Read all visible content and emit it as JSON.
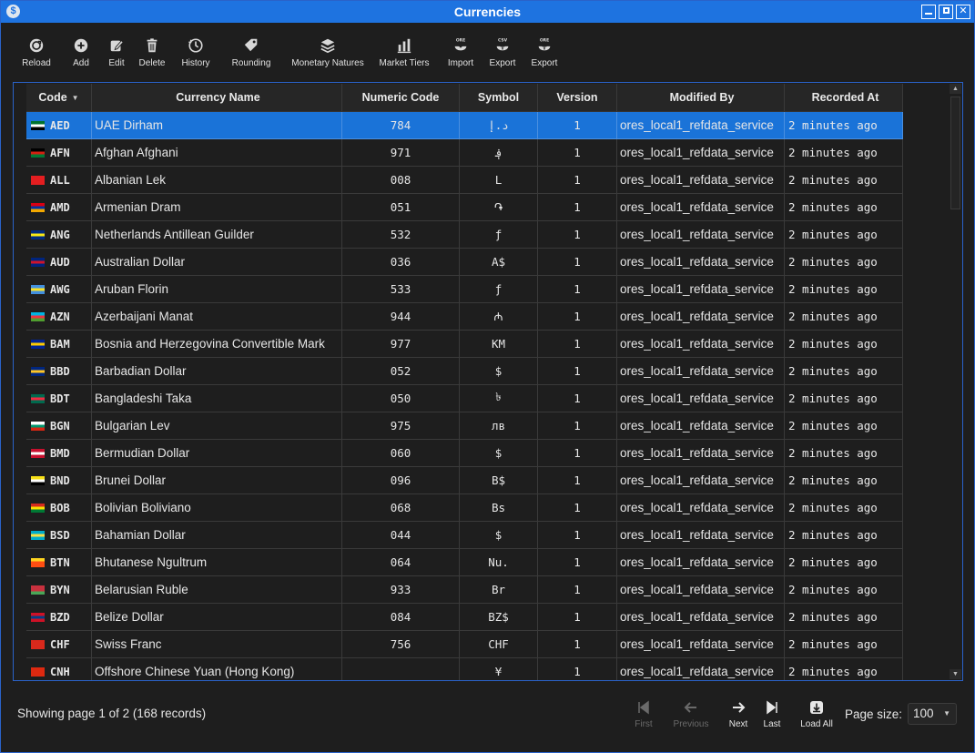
{
  "window": {
    "title": "Currencies",
    "app_icon": "$"
  },
  "toolbar": [
    {
      "name": "reload",
      "label": "Reload"
    },
    {
      "name": "add",
      "label": "Add"
    },
    {
      "name": "edit",
      "label": "Edit"
    },
    {
      "name": "delete",
      "label": "Delete"
    },
    {
      "name": "history",
      "label": "History"
    },
    {
      "name": "rounding",
      "label": "Rounding"
    },
    {
      "name": "monetary-natures",
      "label": "Monetary Natures"
    },
    {
      "name": "market-tiers",
      "label": "Market Tiers"
    },
    {
      "name": "import",
      "label": "Import",
      "badge": "ORE"
    },
    {
      "name": "export-csv",
      "label": "Export",
      "badge": "CSV"
    },
    {
      "name": "export-ore",
      "label": "Export",
      "badge": "ORE"
    }
  ],
  "table": {
    "columns": [
      "Code",
      "Currency Name",
      "Numeric Code",
      "Symbol",
      "Version",
      "Modified By",
      "Recorded At"
    ],
    "rows": [
      {
        "code": "AED",
        "name": "UAE Dirham",
        "numeric": "784",
        "symbol": "د.إ",
        "version": "1",
        "modified_by": "ores_local1_refdata_service",
        "recorded_at": "2 minutes ago",
        "flag": [
          "#00732f",
          "#ffffff",
          "#000000",
          "#ff0000"
        ]
      },
      {
        "code": "AFN",
        "name": "Afghan Afghani",
        "numeric": "971",
        "symbol": "؋",
        "version": "1",
        "modified_by": "ores_local1_refdata_service",
        "recorded_at": "2 minutes ago",
        "flag": [
          "#000000",
          "#d32011",
          "#007a36"
        ]
      },
      {
        "code": "ALL",
        "name": "Albanian Lek",
        "numeric": "008",
        "symbol": "L",
        "version": "1",
        "modified_by": "ores_local1_refdata_service",
        "recorded_at": "2 minutes ago",
        "flag": [
          "#e41e20",
          "#e41e20",
          "#e41e20"
        ]
      },
      {
        "code": "AMD",
        "name": "Armenian Dram",
        "numeric": "051",
        "symbol": "֏",
        "version": "1",
        "modified_by": "ores_local1_refdata_service",
        "recorded_at": "2 minutes ago",
        "flag": [
          "#d90012",
          "#0033a0",
          "#f2a800"
        ]
      },
      {
        "code": "ANG",
        "name": "Netherlands Antillean Guilder",
        "numeric": "532",
        "symbol": "ƒ",
        "version": "1",
        "modified_by": "ores_local1_refdata_service",
        "recorded_at": "2 minutes ago",
        "flag": [
          "#002b7f",
          "#f9e814",
          "#002b7f"
        ]
      },
      {
        "code": "AUD",
        "name": "Australian Dollar",
        "numeric": "036",
        "symbol": "A$",
        "version": "1",
        "modified_by": "ores_local1_refdata_service",
        "recorded_at": "2 minutes ago",
        "flag": [
          "#00247d",
          "#cf142b",
          "#00247d"
        ]
      },
      {
        "code": "AWG",
        "name": "Aruban Florin",
        "numeric": "533",
        "symbol": "ƒ",
        "version": "1",
        "modified_by": "ores_local1_refdata_service",
        "recorded_at": "2 minutes ago",
        "flag": [
          "#418fde",
          "#fbe122",
          "#418fde"
        ]
      },
      {
        "code": "AZN",
        "name": "Azerbaijani Manat",
        "numeric": "944",
        "symbol": "₼",
        "version": "1",
        "modified_by": "ores_local1_refdata_service",
        "recorded_at": "2 minutes ago",
        "flag": [
          "#00b5e2",
          "#ef3340",
          "#509e2f"
        ]
      },
      {
        "code": "BAM",
        "name": "Bosnia and Herzegovina Convertible Mark",
        "numeric": "977",
        "symbol": "KM",
        "version": "1",
        "modified_by": "ores_local1_refdata_service",
        "recorded_at": "2 minutes ago",
        "flag": [
          "#002395",
          "#fecb00",
          "#002395"
        ]
      },
      {
        "code": "BBD",
        "name": "Barbadian Dollar",
        "numeric": "052",
        "symbol": "$",
        "version": "1",
        "modified_by": "ores_local1_refdata_service",
        "recorded_at": "2 minutes ago",
        "flag": [
          "#00267f",
          "#ffc726",
          "#00267f"
        ]
      },
      {
        "code": "BDT",
        "name": "Bangladeshi Taka",
        "numeric": "050",
        "symbol": "৳",
        "version": "1",
        "modified_by": "ores_local1_refdata_service",
        "recorded_at": "2 minutes ago",
        "flag": [
          "#006a4e",
          "#f42a41",
          "#006a4e"
        ]
      },
      {
        "code": "BGN",
        "name": "Bulgarian Lev",
        "numeric": "975",
        "symbol": "лв",
        "version": "1",
        "modified_by": "ores_local1_refdata_service",
        "recorded_at": "2 minutes ago",
        "flag": [
          "#ffffff",
          "#00966e",
          "#d62612"
        ]
      },
      {
        "code": "BMD",
        "name": "Bermudian Dollar",
        "numeric": "060",
        "symbol": "$",
        "version": "1",
        "modified_by": "ores_local1_refdata_service",
        "recorded_at": "2 minutes ago",
        "flag": [
          "#c8102e",
          "#ffffff",
          "#c8102e"
        ]
      },
      {
        "code": "BND",
        "name": "Brunei Dollar",
        "numeric": "096",
        "symbol": "B$",
        "version": "1",
        "modified_by": "ores_local1_refdata_service",
        "recorded_at": "2 minutes ago",
        "flag": [
          "#f7e017",
          "#ffffff",
          "#000000"
        ]
      },
      {
        "code": "BOB",
        "name": "Bolivian Boliviano",
        "numeric": "068",
        "symbol": "Bs",
        "version": "1",
        "modified_by": "ores_local1_refdata_service",
        "recorded_at": "2 minutes ago",
        "flag": [
          "#d52b1e",
          "#f9e300",
          "#007934"
        ]
      },
      {
        "code": "BSD",
        "name": "Bahamian Dollar",
        "numeric": "044",
        "symbol": "$",
        "version": "1",
        "modified_by": "ores_local1_refdata_service",
        "recorded_at": "2 minutes ago",
        "flag": [
          "#00abc9",
          "#fae042",
          "#00abc9"
        ]
      },
      {
        "code": "BTN",
        "name": "Bhutanese Ngultrum",
        "numeric": "064",
        "symbol": "Nu.",
        "version": "1",
        "modified_by": "ores_local1_refdata_service",
        "recorded_at": "2 minutes ago",
        "flag": [
          "#ffd520",
          "#ff4e12",
          "#ff4e12"
        ]
      },
      {
        "code": "BYN",
        "name": "Belarusian Ruble",
        "numeric": "933",
        "symbol": "Br",
        "version": "1",
        "modified_by": "ores_local1_refdata_service",
        "recorded_at": "2 minutes ago",
        "flag": [
          "#c8313e",
          "#c8313e",
          "#4aa657"
        ]
      },
      {
        "code": "BZD",
        "name": "Belize Dollar",
        "numeric": "084",
        "symbol": "BZ$",
        "version": "1",
        "modified_by": "ores_local1_refdata_service",
        "recorded_at": "2 minutes ago",
        "flag": [
          "#ce1126",
          "#003f87",
          "#ce1126"
        ]
      },
      {
        "code": "CHF",
        "name": "Swiss Franc",
        "numeric": "756",
        "symbol": "CHF",
        "version": "1",
        "modified_by": "ores_local1_refdata_service",
        "recorded_at": "2 minutes ago",
        "flag": [
          "#da291c",
          "#da291c",
          "#da291c"
        ]
      },
      {
        "code": "CNH",
        "name": "Offshore Chinese Yuan (Hong Kong)",
        "numeric": "",
        "symbol": "¥",
        "version": "1",
        "modified_by": "ores_local1_refdata_service",
        "recorded_at": "2 minutes ago",
        "flag": [
          "#de2910",
          "#de2910",
          "#de2910"
        ]
      }
    ],
    "selected_index": 0
  },
  "footer": {
    "status": "Showing page 1 of 2 (168 records)",
    "pager": [
      {
        "name": "first",
        "label": "First",
        "enabled": false
      },
      {
        "name": "previous",
        "label": "Previous",
        "enabled": false
      },
      {
        "name": "next",
        "label": "Next",
        "enabled": true
      },
      {
        "name": "last",
        "label": "Last",
        "enabled": true
      },
      {
        "name": "load-all",
        "label": "Load All",
        "enabled": true
      }
    ],
    "page_size_label": "Page size:",
    "page_size": "100"
  },
  "colors": {
    "accent": "#1a73d8",
    "titlebar": "#1e73e0",
    "background": "#1e1e1e"
  }
}
